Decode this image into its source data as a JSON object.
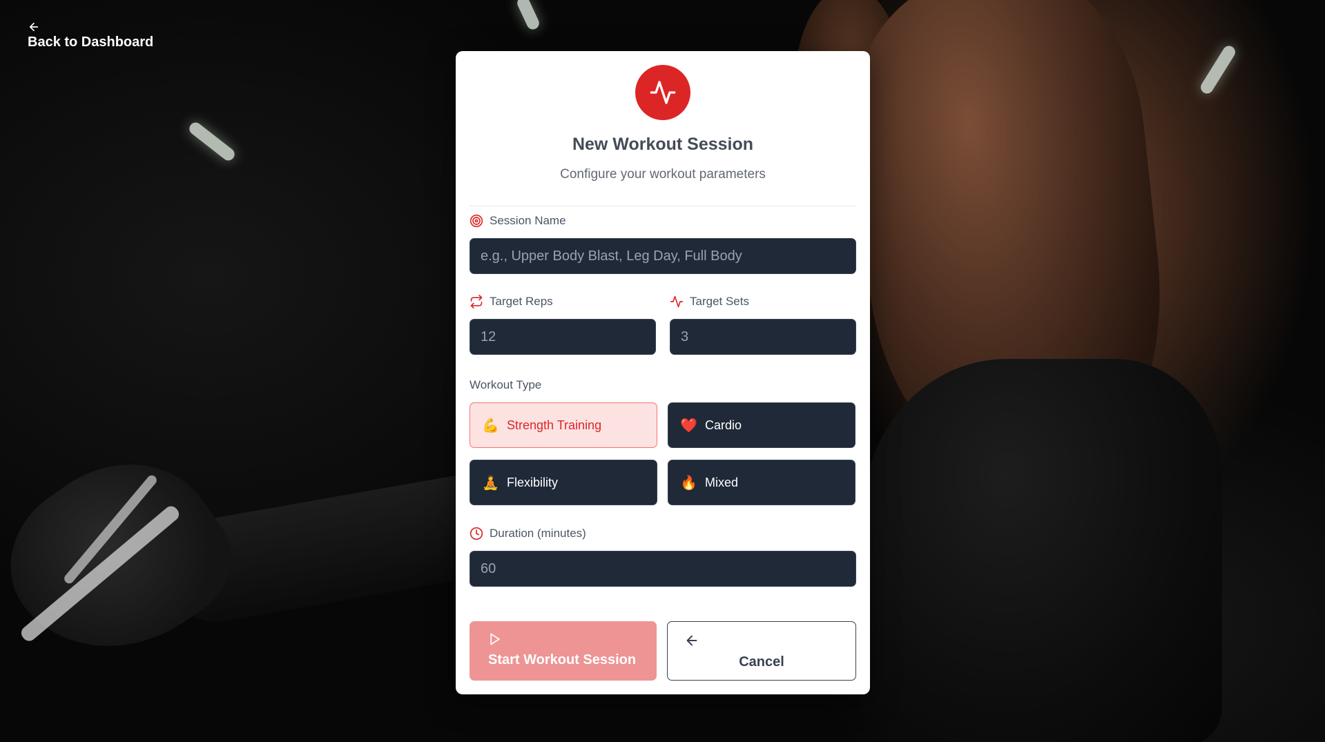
{
  "nav": {
    "back_label": "Back to Dashboard"
  },
  "header": {
    "title": "New Workout Session",
    "subtitle": "Configure your workout parameters"
  },
  "session_name": {
    "label": "Session Name",
    "placeholder": "e.g., Upper Body Blast, Leg Day, Full Body",
    "value": ""
  },
  "target_reps": {
    "label": "Target Reps",
    "value": "12"
  },
  "target_sets": {
    "label": "Target Sets",
    "value": "3"
  },
  "workout_type": {
    "label": "Workout Type",
    "selected": "Strength Training",
    "options": [
      {
        "label": "Strength Training",
        "emoji": "💪"
      },
      {
        "label": "Cardio",
        "emoji": "❤️"
      },
      {
        "label": "Flexibility",
        "emoji": "🧘"
      },
      {
        "label": "Mixed",
        "emoji": "🔥"
      }
    ]
  },
  "duration": {
    "label": "Duration (minutes)",
    "value": "60"
  },
  "actions": {
    "start_label": "Start Workout Session",
    "cancel_label": "Cancel"
  },
  "colors": {
    "accent": "#dc2626",
    "input_bg": "#1f2937",
    "start_button_bg": "#ee9494",
    "selected_bg": "#fde2e2"
  },
  "icons": {
    "back": "arrow-left-icon",
    "logo": "activity-pulse-icon",
    "session_name": "target-icon",
    "reps": "repeat-icon",
    "sets": "activity-icon",
    "duration": "clock-icon",
    "start": "play-icon",
    "cancel": "arrow-left-icon"
  }
}
